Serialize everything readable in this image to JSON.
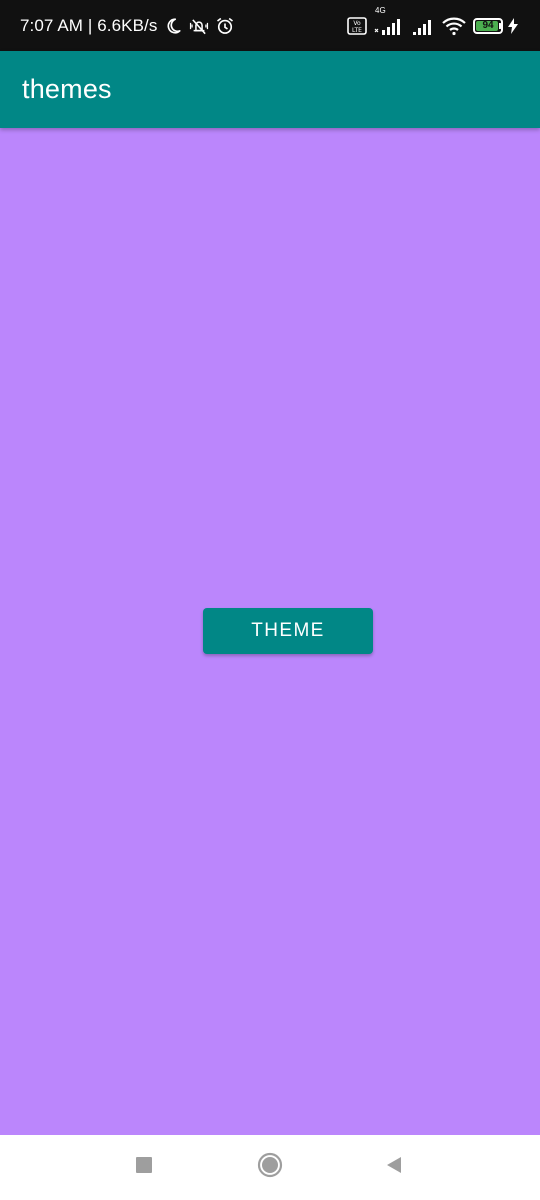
{
  "status_bar": {
    "time_speed": "7:07 AM | 6.6KB/s",
    "network_label": "4G",
    "battery_level": "94",
    "battery_color": "#4caf50",
    "icons": [
      "moon-icon",
      "mute-vibrate-icon",
      "alarm-icon",
      "volte-icon",
      "signal-icon",
      "signal-icon-2",
      "wifi-icon",
      "battery-icon",
      "charging-icon"
    ]
  },
  "app_bar": {
    "title": "themes",
    "color": "#018786"
  },
  "main": {
    "background": "#bb86fc",
    "theme_button_label": "THEME"
  },
  "nav_bar": {
    "icons": [
      "recents-icon",
      "home-icon",
      "back-icon"
    ]
  }
}
